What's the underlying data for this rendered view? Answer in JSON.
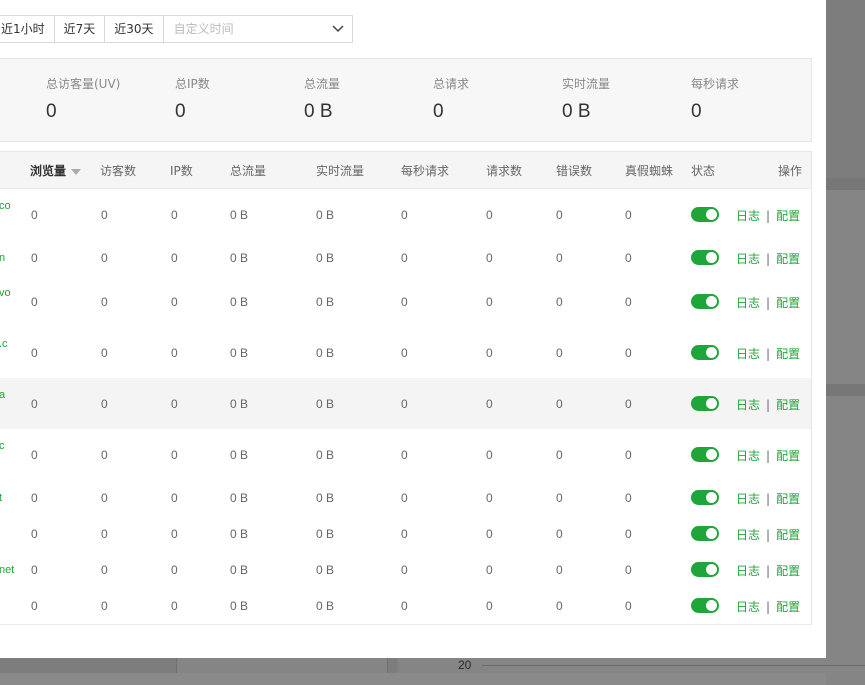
{
  "time_filter": {
    "options": [
      "近1小时",
      "近7天",
      "近30天"
    ],
    "custom_placeholder": "自定义时间"
  },
  "stats": [
    {
      "label": "总访客量(UV)",
      "value": "0"
    },
    {
      "label": "总IP数",
      "value": "0"
    },
    {
      "label": "总流量",
      "value": "0 B"
    },
    {
      "label": "总请求",
      "value": "0"
    },
    {
      "label": "实时流量",
      "value": "0 B"
    },
    {
      "label": "每秒请求",
      "value": "0"
    }
  ],
  "table": {
    "headers": {
      "pv": "浏览量",
      "visitors": "访客数",
      "ip": "IP数",
      "traffic": "总流量",
      "realtime": "实时流量",
      "qps": "每秒请求",
      "requests": "请求数",
      "errors": "错误数",
      "spider": "真假蜘蛛",
      "status": "状态",
      "action": "操作"
    },
    "action_labels": {
      "log": "日志",
      "separator": "|",
      "config": "配置"
    },
    "rows": [
      {
        "site": "co",
        "pv": "0",
        "visitors": "0",
        "ip": "0",
        "traffic": "0 B",
        "realtime": "0 B",
        "qps": "0",
        "requests": "0",
        "errors": "0",
        "spider": "0",
        "enabled": true
      },
      {
        "site": "n",
        "pv": "0",
        "visitors": "0",
        "ip": "0",
        "traffic": "0 B",
        "realtime": "0 B",
        "qps": "0",
        "requests": "0",
        "errors": "0",
        "spider": "0",
        "enabled": true
      },
      {
        "site": "vo",
        "pv": "0",
        "visitors": "0",
        "ip": "0",
        "traffic": "0 B",
        "realtime": "0 B",
        "qps": "0",
        "requests": "0",
        "errors": "0",
        "spider": "0",
        "enabled": true
      },
      {
        "site": ".c",
        "pv": "0",
        "visitors": "0",
        "ip": "0",
        "traffic": "0 B",
        "realtime": "0 B",
        "qps": "0",
        "requests": "0",
        "errors": "0",
        "spider": "0",
        "enabled": true
      },
      {
        "site": "a",
        "pv": "0",
        "visitors": "0",
        "ip": "0",
        "traffic": "0 B",
        "realtime": "0 B",
        "qps": "0",
        "requests": "0",
        "errors": "0",
        "spider": "0",
        "enabled": true
      },
      {
        "site": "c",
        "pv": "0",
        "visitors": "0",
        "ip": "0",
        "traffic": "0 B",
        "realtime": "0 B",
        "qps": "0",
        "requests": "0",
        "errors": "0",
        "spider": "0",
        "enabled": true
      },
      {
        "site": "t",
        "pv": "0",
        "visitors": "0",
        "ip": "0",
        "traffic": "0 B",
        "realtime": "0 B",
        "qps": "0",
        "requests": "0",
        "errors": "0",
        "spider": "0",
        "enabled": true
      },
      {
        "site": "",
        "pv": "0",
        "visitors": "0",
        "ip": "0",
        "traffic": "0 B",
        "realtime": "0 B",
        "qps": "0",
        "requests": "0",
        "errors": "0",
        "spider": "0",
        "enabled": true
      },
      {
        "site": "net",
        "pv": "0",
        "visitors": "0",
        "ip": "0",
        "traffic": "0 B",
        "realtime": "0 B",
        "qps": "0",
        "requests": "0",
        "errors": "0",
        "spider": "0",
        "enabled": true
      },
      {
        "site": "",
        "pv": "0",
        "visitors": "0",
        "ip": "0",
        "traffic": "0 B",
        "realtime": "0 B",
        "qps": "0",
        "requests": "0",
        "errors": "0",
        "spider": "0",
        "enabled": true
      }
    ]
  },
  "background": {
    "axis_tick": "20"
  }
}
